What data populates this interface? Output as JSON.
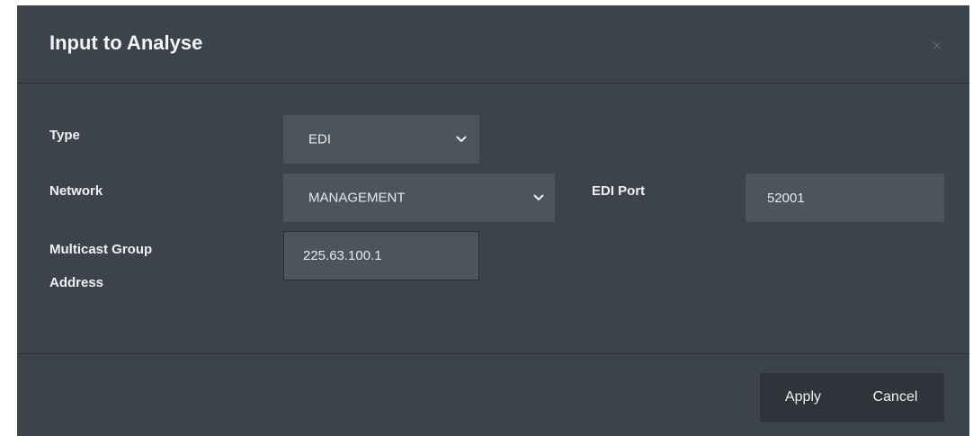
{
  "dialog": {
    "title": "Input to Analyse",
    "close_glyph": "×",
    "close_icon": "close-icon"
  },
  "form": {
    "type": {
      "label": "Type",
      "value": "EDI",
      "icon": "chevron-down-icon"
    },
    "network": {
      "label": "Network",
      "value": "MANAGEMENT",
      "icon": "chevron-down-icon"
    },
    "edi_port": {
      "label": "EDI Port",
      "value": "52001"
    },
    "multicast": {
      "label_line1": "Multicast Group",
      "label_line2": "Address",
      "value": "225.63.100.1"
    }
  },
  "footer": {
    "apply_label": "Apply",
    "cancel_label": "Cancel"
  },
  "colors": {
    "modal_bg": "#3c434b",
    "field_bg": "#4c545c",
    "button_group_bg": "#2e343a",
    "divider": "#2a3036",
    "text": "#eef0f2"
  }
}
